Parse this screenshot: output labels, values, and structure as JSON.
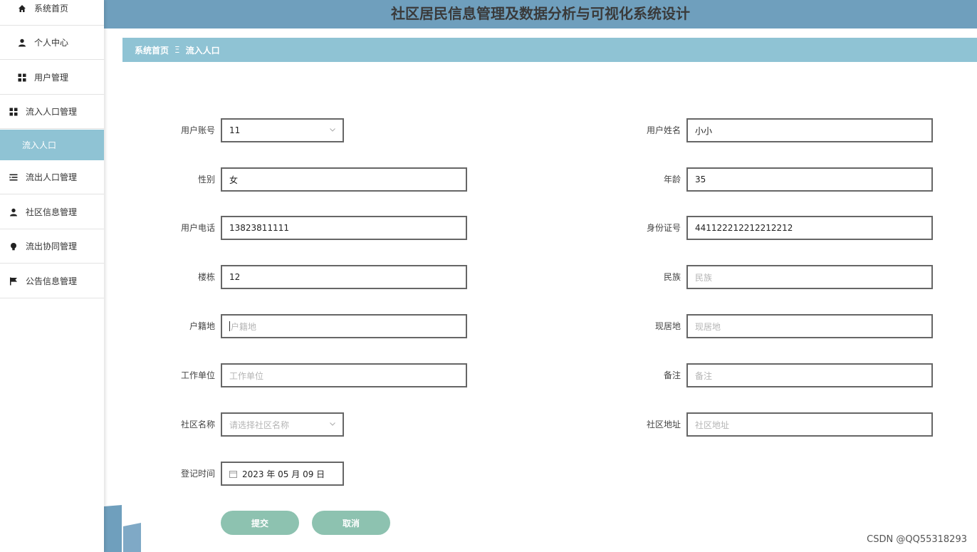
{
  "header": {
    "title": "社区居民信息管理及数据分析与可视化系统设计"
  },
  "sidebar": {
    "items": [
      {
        "label": "系统首页",
        "icon": "home-icon"
      },
      {
        "label": "个人中心",
        "icon": "user-icon"
      },
      {
        "label": "用户管理",
        "icon": "grid-icon"
      },
      {
        "label": "流入人口管理",
        "icon": "grid-icon"
      },
      {
        "label": "流入人口",
        "icon": ""
      },
      {
        "label": "流出人口管理",
        "icon": "list-icon"
      },
      {
        "label": "社区信息管理",
        "icon": "user-icon"
      },
      {
        "label": "流出协同管理",
        "icon": "bulb-icon"
      },
      {
        "label": "公告信息管理",
        "icon": "flag-icon"
      }
    ]
  },
  "breadcrumb": {
    "home": "系统首页",
    "separator": "Ξ",
    "current": "流入人口"
  },
  "form": {
    "account": {
      "label": "用户账号",
      "value": "11"
    },
    "name": {
      "label": "用户姓名",
      "value": "小小"
    },
    "gender": {
      "label": "性别",
      "value": "女"
    },
    "age": {
      "label": "年龄",
      "value": "35"
    },
    "phone": {
      "label": "用户电话",
      "value": "13823811111"
    },
    "idcard": {
      "label": "身份证号",
      "value": "441122212212212212"
    },
    "building": {
      "label": "楼栋",
      "value": "12"
    },
    "ethnicity": {
      "label": "民族",
      "placeholder": "民族"
    },
    "hometown": {
      "label": "户籍地",
      "placeholder": "户籍地"
    },
    "residence": {
      "label": "现居地",
      "placeholder": "现居地"
    },
    "workplace": {
      "label": "工作单位",
      "placeholder": "工作单位"
    },
    "remark": {
      "label": "备注",
      "placeholder": "备注"
    },
    "community": {
      "label": "社区名称",
      "placeholder": "请选择社区名称"
    },
    "address": {
      "label": "社区地址",
      "placeholder": "社区地址"
    },
    "regtime": {
      "label": "登记时间",
      "value": "2023 年 05 月 09 日"
    }
  },
  "buttons": {
    "submit": "提交",
    "cancel": "取消"
  },
  "watermark": "CSDN @QQ55318293",
  "colors": {
    "header": "#6f9fbd",
    "accent": "#8fc3d4",
    "button": "#8dc2b0"
  }
}
